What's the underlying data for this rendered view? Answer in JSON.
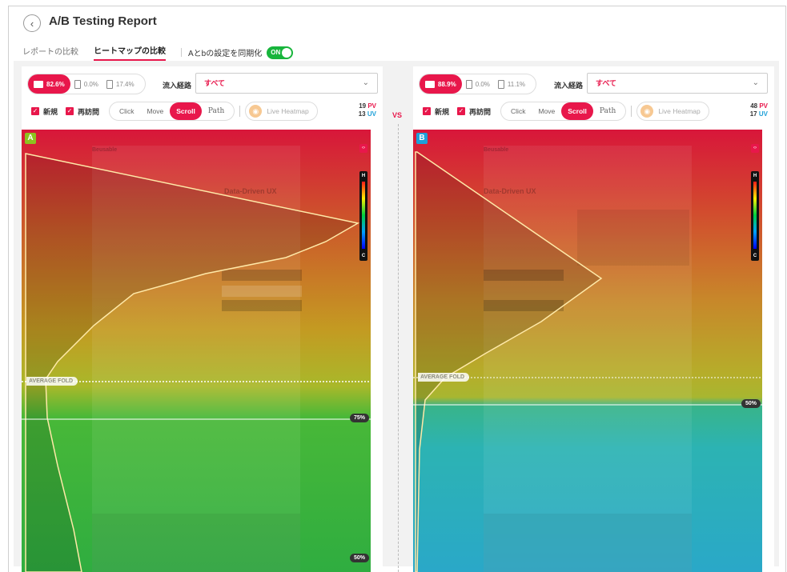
{
  "header": {
    "title": "A/B Testing Report",
    "back_icon": "chevron-left-icon"
  },
  "tabs": [
    {
      "label": "レポートの比較",
      "active": false
    },
    {
      "label": "ヒートマップの比較",
      "active": true
    }
  ],
  "sync": {
    "label": "Aとbの設定を同期化",
    "toggle_label": "ON",
    "on": true
  },
  "vs_label": "VS",
  "panels": [
    {
      "badge": "A",
      "badge_color": "#8dc21f",
      "devices": {
        "pc": "82.6%",
        "mobile": "0.0%",
        "tablet": "17.4%"
      },
      "source_label": "流入経路",
      "source_value": "すべて",
      "checks": {
        "new": "新規",
        "returning": "再訪問"
      },
      "modes": [
        "Click",
        "Move",
        "Scroll",
        "Path"
      ],
      "active_mode": "Scroll",
      "live_label": "Live Heatmap",
      "stats": {
        "pv_num": "19",
        "pv_label": "PV",
        "uv_num": "13",
        "uv_label": "UV"
      },
      "fold_label": "AVERAGE FOLD",
      "markers": [
        "75%",
        "50%"
      ],
      "ghost_heading": "Data-Driven UX",
      "ghost_logo": "Beusable"
    },
    {
      "badge": "B",
      "badge_color": "#1ea0d8",
      "devices": {
        "pc": "88.9%",
        "mobile": "0.0%",
        "tablet": "11.1%"
      },
      "source_label": "流入経路",
      "source_value": "すべて",
      "checks": {
        "new": "新規",
        "returning": "再訪問"
      },
      "modes": [
        "Click",
        "Move",
        "Scroll",
        "Path"
      ],
      "active_mode": "Scroll",
      "live_label": "Live Heatmap",
      "stats": {
        "pv_num": "48",
        "pv_label": "PV",
        "uv_num": "17",
        "uv_label": "UV"
      },
      "fold_label": "AVERAGE FOLD",
      "markers": [
        "50%"
      ],
      "ghost_heading": "Data-Driven UX",
      "ghost_logo": "Beusable"
    }
  ],
  "legend": {
    "high": "H",
    "low": "C"
  },
  "colors": {
    "accent": "#e8174b",
    "uv": "#1ea0d8",
    "toggle_on": "#18b53c"
  }
}
